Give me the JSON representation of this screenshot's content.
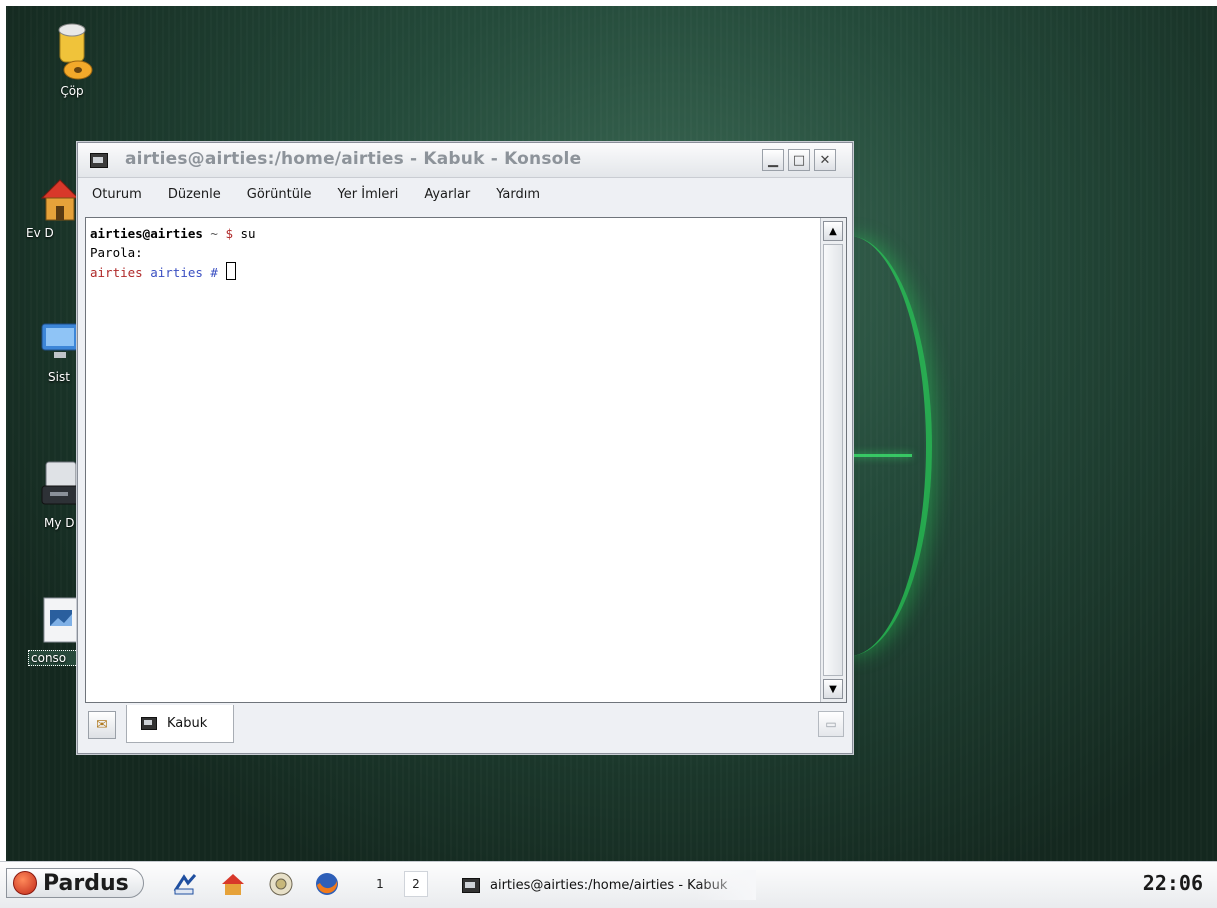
{
  "desktop": {
    "icons": [
      {
        "label": "Çöp",
        "icon": "trash-icon"
      },
      {
        "label": "Ev D",
        "icon": "home-folder-icon"
      },
      {
        "label": "Sist",
        "icon": "monitor-icon"
      },
      {
        "label": "My D",
        "icon": "drive-icon"
      },
      {
        "label": "conso",
        "icon": "console-shortcut-icon"
      }
    ]
  },
  "window": {
    "title": "airties@airties:/home/airties - Kabuk - Konsole",
    "controls": {
      "minimize": "▁",
      "maximize": "□",
      "close": "✕"
    },
    "menu": [
      "Oturum",
      "Düzenle",
      "Görüntüle",
      "Yer İmleri",
      "Ayarlar",
      "Yardım"
    ],
    "terminal": {
      "line1": {
        "user_host": "airties@airties",
        "path": " ~ ",
        "prompt": "$",
        "command": " su"
      },
      "line2": "Parola:",
      "line3": {
        "user": "airties",
        "dir": " airties",
        "prompt": " #"
      }
    },
    "scroll": {
      "up": "▲",
      "down": "▼"
    },
    "tabs": [
      {
        "label": "Kabuk",
        "icon": "terminal-icon"
      }
    ],
    "new_tab_glyph": "✉",
    "close_tab_glyph": "▭"
  },
  "taskbar": {
    "start_label": "Pardus",
    "quick_launch": [
      "kate-icon",
      "home-icon",
      "help-icon",
      "firefox-icon"
    ],
    "desktops": [
      "1",
      "2"
    ],
    "active_task": "airties@airties:/home/airties - Kabuk",
    "clock": "22:06"
  },
  "colors": {
    "prompt_red": "#b02a2a",
    "prompt_blue": "#3a4fc2"
  }
}
